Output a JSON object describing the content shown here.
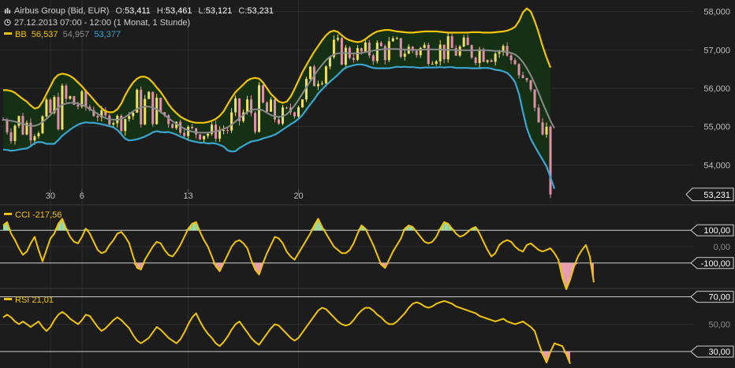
{
  "header": {
    "instrument": "Airbus Group (Bid, EUR)",
    "open_label": "O:",
    "open": "53,411",
    "high_label": "H:",
    "high": "53,461",
    "low_label": "L:",
    "low": "53,121",
    "close_label": "C:",
    "close": "53,231",
    "time_range": "27.12.2013 07:00 - 12:00 (1 Monat, 1 Stunde)",
    "bb_label": "BB",
    "bb_upper": "56,537",
    "bb_middle": "54,957",
    "bb_lower": "53,377"
  },
  "colors": {
    "background": "#1c1c1c",
    "grid": "#2e2e2e",
    "band_upper": "#f0c400",
    "band_middle": "#8a8a8a",
    "band_lower": "#3aa6d0",
    "band_fill": "#163016",
    "candle_up": "#f0e060",
    "candle_down": "#e090a8",
    "indicator_line": "#f0c400",
    "fill_overbought": "#a0d8a0",
    "fill_oversold": "#e8a0b0"
  },
  "indicators": {
    "cci_label": "CCI",
    "cci_value": "-217,56",
    "rsi_label": "RSI",
    "rsi_value": "21,01"
  },
  "chart_data": [
    {
      "type": "line",
      "panel": "price",
      "series_kind": "candlestick_with_bollinger_bands",
      "x_tick_labels": [
        "30",
        "6",
        "13",
        "20"
      ],
      "y_tick_labels": [
        "54,000",
        "55,000",
        "56,000",
        "57,000",
        "58,000"
      ],
      "ylim": [
        53.0,
        58.3
      ],
      "last_price_label": "53,231",
      "series": [
        {
          "name": "BB",
          "values": [
            55.95,
            55.95,
            55.93,
            55.88,
            55.8,
            55.72,
            55.65,
            55.55,
            55.47,
            55.5,
            55.65,
            55.85,
            56.05,
            56.25,
            56.35,
            56.38,
            56.36,
            56.32,
            56.25,
            56.15,
            56.05,
            55.93,
            55.82,
            55.7,
            55.58,
            55.48,
            55.4,
            55.37,
            55.38,
            55.45,
            55.6,
            55.82,
            56.0,
            56.15,
            56.25,
            56.3,
            56.3,
            56.25,
            56.15,
            56.02,
            55.9,
            55.75,
            55.58,
            55.45,
            55.35,
            55.26,
            55.2,
            55.15,
            55.12,
            55.1,
            55.1,
            55.1,
            55.12,
            55.15,
            55.2,
            55.28,
            55.4,
            55.58,
            55.75,
            55.9,
            56.0,
            56.1,
            56.2,
            56.25,
            56.27,
            56.25,
            56.15,
            56.0,
            55.85,
            55.75,
            55.65,
            55.62,
            55.65,
            55.78,
            55.98,
            56.2,
            56.42,
            56.6,
            56.78,
            56.95,
            57.1,
            57.25,
            57.38,
            57.47,
            57.5,
            57.47,
            57.38,
            57.3,
            57.25,
            57.22,
            57.2,
            57.22,
            57.28,
            57.36,
            57.43,
            57.48,
            57.5,
            57.52,
            57.52,
            57.5,
            57.48,
            57.47,
            57.46,
            57.45,
            57.45,
            57.46,
            57.47,
            57.48,
            57.48,
            57.48,
            57.48,
            57.47,
            57.46,
            57.45,
            57.45,
            57.45,
            57.45,
            57.45,
            57.45,
            57.46,
            57.46,
            57.46,
            57.45,
            57.45,
            57.45,
            57.46,
            57.47,
            57.48,
            57.5,
            57.54,
            57.6,
            57.75,
            57.98,
            58.08,
            58.0,
            57.75,
            57.45,
            57.1,
            56.8,
            56.537
          ]
        },
        {
          "name": "BB middle",
          "values": [
            55.18,
            55.17,
            55.15,
            55.13,
            55.1,
            55.07,
            55.04,
            55.02,
            55.02,
            55.05,
            55.12,
            55.2,
            55.3,
            55.4,
            55.5,
            55.57,
            55.6,
            55.62,
            55.62,
            55.6,
            55.57,
            55.52,
            55.46,
            55.4,
            55.33,
            55.27,
            55.22,
            55.19,
            55.18,
            55.18,
            55.2,
            55.25,
            55.32,
            55.4,
            55.46,
            55.5,
            55.52,
            55.52,
            55.5,
            55.45,
            55.38,
            55.3,
            55.22,
            55.14,
            55.07,
            55.0,
            54.95,
            54.9,
            54.87,
            54.85,
            54.84,
            54.84,
            54.84,
            54.86,
            54.88,
            54.9,
            54.94,
            54.98,
            55.05,
            55.13,
            55.22,
            55.3,
            55.38,
            55.43,
            55.45,
            55.45,
            55.42,
            55.36,
            55.3,
            55.27,
            55.25,
            55.27,
            55.32,
            55.42,
            55.55,
            55.7,
            55.86,
            56.02,
            56.18,
            56.33,
            56.48,
            56.61,
            56.73,
            56.82,
            56.88,
            56.91,
            56.92,
            56.92,
            56.91,
            56.91,
            56.91,
            56.92,
            56.94,
            56.96,
            56.98,
            57.0,
            57.01,
            57.02,
            57.02,
            57.02,
            57.02,
            57.01,
            57.01,
            57.0,
            57.0,
            57.0,
            57.0,
            57.01,
            57.01,
            57.01,
            57.01,
            57.01,
            57.0,
            57.0,
            57.0,
            56.99,
            56.99,
            56.99,
            56.99,
            56.99,
            56.99,
            56.99,
            56.99,
            56.99,
            56.98,
            56.97,
            56.97,
            56.96,
            56.95,
            56.92,
            56.88,
            56.8,
            56.68,
            56.52,
            56.34,
            56.12,
            55.88,
            55.62,
            55.38,
            55.15,
            54.957
          ]
        },
        {
          "name": "BB lower",
          "values": [
            54.4,
            54.39,
            54.37,
            54.38,
            54.4,
            54.42,
            54.43,
            54.49,
            54.57,
            54.6,
            54.59,
            54.55,
            54.55,
            54.55,
            54.65,
            54.76,
            54.84,
            54.92,
            54.99,
            55.05,
            55.09,
            55.11,
            55.1,
            55.1,
            55.08,
            55.06,
            55.04,
            55.01,
            54.98,
            54.91,
            54.8,
            54.68,
            54.64,
            54.65,
            54.67,
            54.7,
            54.74,
            54.79,
            54.85,
            54.88,
            54.86,
            54.85,
            54.86,
            54.83,
            54.79,
            54.74,
            54.7,
            54.65,
            54.62,
            54.6,
            54.58,
            54.58,
            54.56,
            54.57,
            54.56,
            54.52,
            54.48,
            54.38,
            54.35,
            54.36,
            54.44,
            54.5,
            54.56,
            54.61,
            54.63,
            54.65,
            54.69,
            54.72,
            54.75,
            54.79,
            54.85,
            54.92,
            54.99,
            55.06,
            55.12,
            55.2,
            55.3,
            55.44,
            55.58,
            55.71,
            55.86,
            55.97,
            56.08,
            56.17,
            56.26,
            56.35,
            56.46,
            56.54,
            56.57,
            56.6,
            56.62,
            56.62,
            56.6,
            56.56,
            56.53,
            56.52,
            56.52,
            56.52,
            56.52,
            56.54,
            56.56,
            56.55,
            56.56,
            56.55,
            56.55,
            56.54,
            56.53,
            56.54,
            56.54,
            56.54,
            56.54,
            56.55,
            56.54,
            56.55,
            56.55,
            56.53,
            56.53,
            56.53,
            56.53,
            56.52,
            56.52,
            56.52,
            56.53,
            56.53,
            56.51,
            56.48,
            56.47,
            56.44,
            56.4,
            56.3,
            56.16,
            55.85,
            55.38,
            54.96,
            54.68,
            54.49,
            54.31,
            54.14,
            53.96,
            53.68,
            53.377
          ]
        }
      ]
    },
    {
      "type": "area",
      "panel": "cci",
      "y_tick_labels": [
        "100,00",
        "0,00",
        "-100,00"
      ],
      "ylim": [
        -250,
        250
      ],
      "series": [
        {
          "name": "CCI",
          "values": [
            130,
            150,
            80,
            40,
            -10,
            -50,
            -30,
            20,
            60,
            -20,
            -90,
            -20,
            50,
            80,
            140,
            170,
            110,
            60,
            30,
            20,
            60,
            110,
            80,
            30,
            -20,
            -40,
            -30,
            10,
            40,
            80,
            90,
            60,
            20,
            -60,
            -130,
            -140,
            -80,
            -40,
            0,
            30,
            20,
            -20,
            -50,
            -60,
            -30,
            10,
            60,
            110,
            140,
            150,
            90,
            40,
            0,
            -60,
            -120,
            -150,
            -100,
            -50,
            0,
            30,
            40,
            20,
            -10,
            -80,
            -140,
            -170,
            -100,
            -40,
            10,
            60,
            50,
            20,
            -30,
            -60,
            -80,
            -40,
            0,
            40,
            80,
            130,
            170,
            120,
            80,
            40,
            0,
            -20,
            -40,
            -40,
            -20,
            20,
            80,
            130,
            110,
            60,
            10,
            -50,
            -110,
            -130,
            -80,
            -30,
            10,
            50,
            110,
            130,
            120,
            90,
            60,
            30,
            20,
            30,
            60,
            110,
            150,
            140,
            110,
            80,
            60,
            70,
            90,
            110,
            120,
            80,
            30,
            -20,
            -60,
            -40,
            10,
            30,
            40,
            30,
            0,
            -20,
            -30,
            10,
            20,
            0,
            -20,
            -30,
            -20,
            -10,
            -40,
            -80,
            -190,
            -260,
            -200,
            -120,
            -60,
            -20,
            10,
            -60,
            -217.56
          ]
        }
      ]
    },
    {
      "type": "area",
      "panel": "rsi",
      "y_tick_labels": [
        "70,00",
        "50,00",
        "30,00"
      ],
      "ylim": [
        18,
        75
      ],
      "series": [
        {
          "name": "RSI",
          "values": [
            55,
            57,
            55,
            52,
            50,
            52,
            50,
            48,
            50,
            52,
            48,
            45,
            48,
            53,
            57,
            59,
            57,
            54,
            52,
            50,
            53,
            57,
            56,
            52,
            48,
            45,
            47,
            50,
            53,
            55,
            53,
            50,
            47,
            42,
            38,
            36,
            38,
            40,
            44,
            48,
            46,
            43,
            40,
            38,
            36,
            39,
            44,
            50,
            55,
            58,
            52,
            47,
            43,
            40,
            36,
            34,
            37,
            41,
            46,
            50,
            52,
            48,
            44,
            40,
            37,
            35,
            39,
            43,
            47,
            50,
            49,
            46,
            43,
            40,
            38,
            40,
            44,
            48,
            52,
            56,
            60,
            62,
            61,
            58,
            55,
            52,
            50,
            49,
            50,
            53,
            57,
            60,
            62,
            62,
            60,
            57,
            55,
            52,
            50,
            50,
            52,
            55,
            58,
            62,
            65,
            66,
            65,
            63,
            62,
            63,
            65,
            66,
            67,
            66,
            65,
            63,
            62,
            61,
            60,
            59,
            58,
            56,
            55,
            54,
            53,
            52,
            53,
            54,
            52,
            51,
            50,
            51,
            52,
            50,
            48,
            45,
            36,
            28,
            22,
            30,
            36,
            35,
            34,
            28,
            21.01
          ]
        }
      ]
    }
  ]
}
